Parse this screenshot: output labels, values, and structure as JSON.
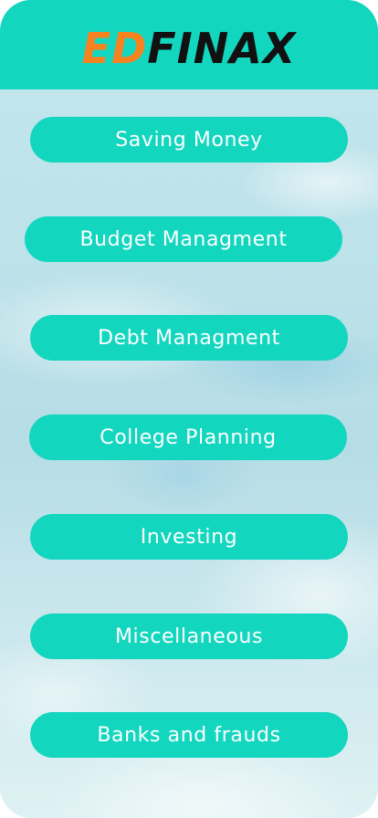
{
  "header": {
    "logo_part1": "ED",
    "logo_part2": "FINAX",
    "background_color": "#13d6bf",
    "logo_accent_color": "#f7811e"
  },
  "menu": {
    "button_color": "#13d6bf",
    "items": [
      {
        "label": "Saving Money"
      },
      {
        "label": "Budget Managment"
      },
      {
        "label": "Debt Managment"
      },
      {
        "label": "College Planning"
      },
      {
        "label": "Investing"
      },
      {
        "label": "Miscellaneous"
      },
      {
        "label": "Banks and frauds"
      }
    ]
  }
}
